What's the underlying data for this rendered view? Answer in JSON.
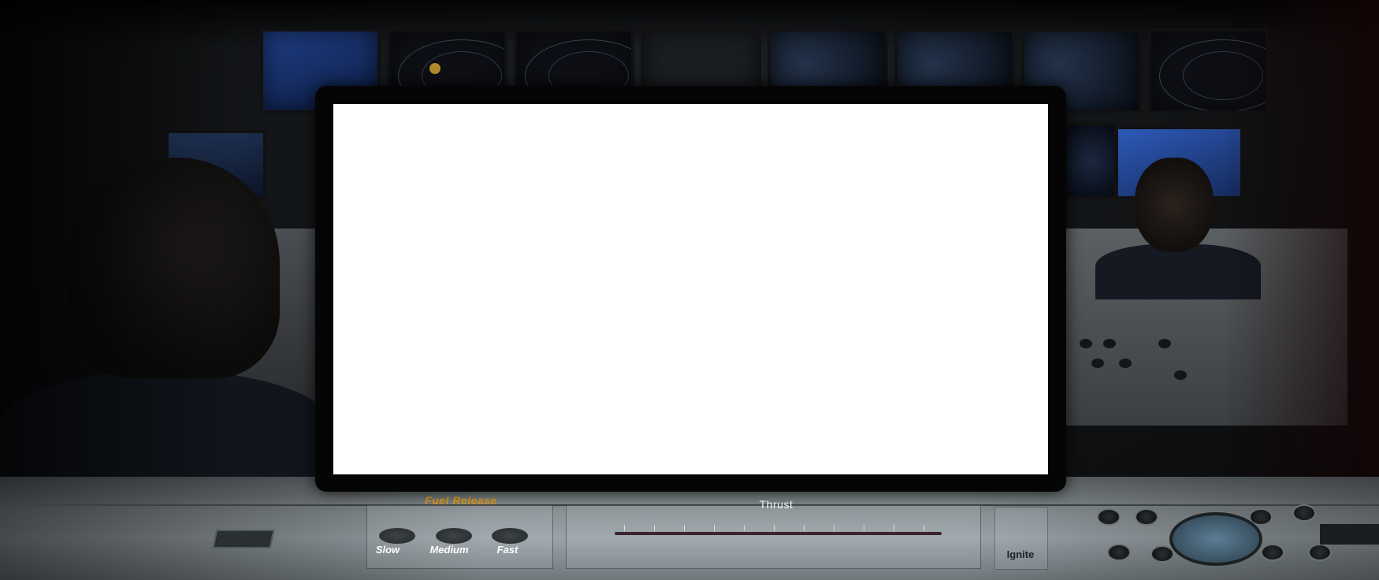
{
  "controls": {
    "fuel_release": {
      "title": "Fuel Release",
      "options": [
        "Slow",
        "Medium",
        "Fast"
      ]
    },
    "thrust": {
      "label": "Thrust"
    },
    "ignite": {
      "label": "Ignite"
    }
  },
  "colors": {
    "fuel_title": "#e39b16",
    "screen": "#ffffff",
    "bezel": "#050505"
  }
}
